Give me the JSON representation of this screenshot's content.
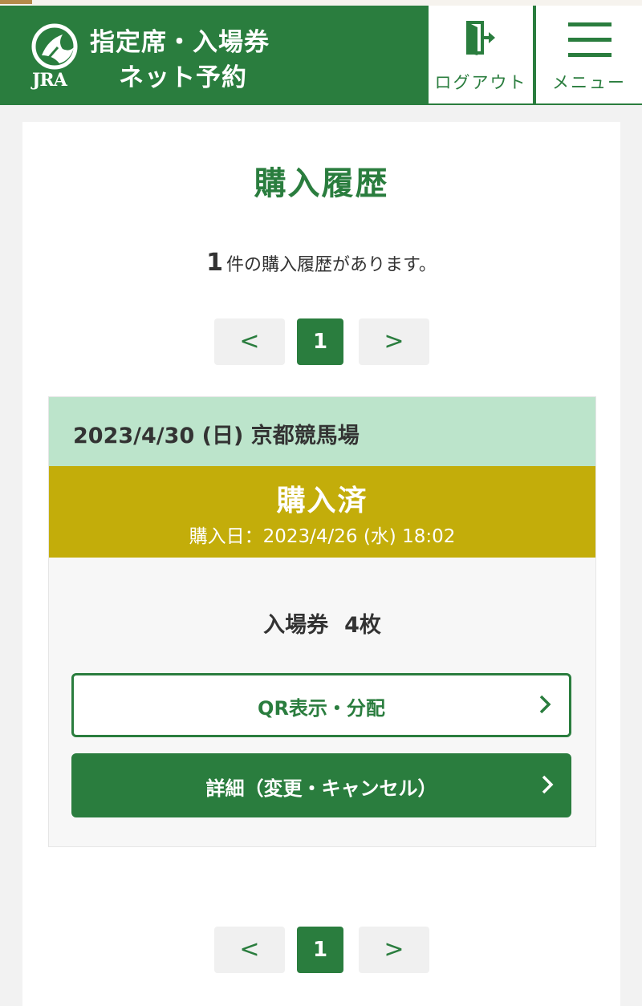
{
  "header": {
    "logo_text": "JRA",
    "title_line1": "指定席・入場券",
    "title_line2": "ネット予約",
    "logout_label": "ログアウト",
    "menu_label": "メニュー",
    "icons": {
      "logout": "logout-door-icon",
      "menu": "hamburger-menu-icon"
    }
  },
  "main": {
    "title": "購入履歴",
    "count": "1",
    "count_suffix": "件の購入履歴があります。"
  },
  "pagination": {
    "prev": "<",
    "current": "1",
    "next": ">"
  },
  "history": [
    {
      "race_date": "2023/4/30 (日) 京都競馬場",
      "status": "購入済",
      "purchase_date": "購入日：2023/4/26 (水) 18:02",
      "ticket_type": "入場券",
      "ticket_qty": "4枚",
      "qr_button": "QR表示・分配",
      "detail_button": "詳細（変更・キャンセル）"
    }
  ],
  "colors": {
    "brand_green": "#2a7d3e",
    "header_row": "#bce4cb",
    "status_bar": "#c3ad0a",
    "page_bg": "#f2f2f2"
  }
}
